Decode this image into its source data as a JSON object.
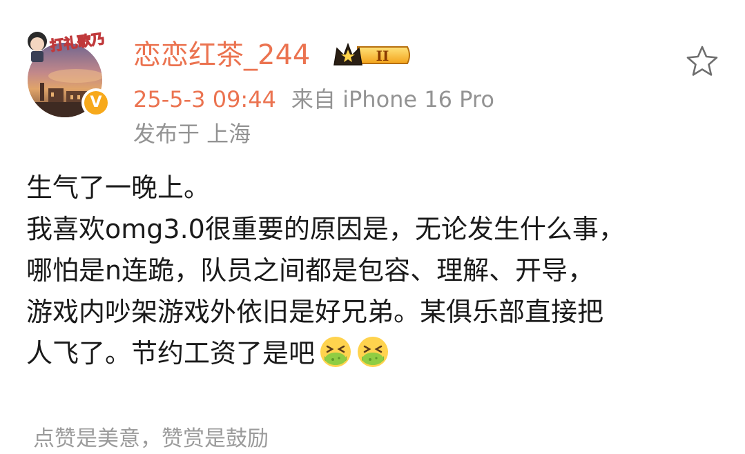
{
  "post": {
    "author": {
      "username": "恋恋红茶_244",
      "avatar_decoration_text": "打礼歌乃",
      "verified_icon": "verified-v-icon",
      "verified_glyph": "V",
      "crown_badge_icon": "crown-badge-icon",
      "crown_badge_level": "II"
    },
    "meta": {
      "time": "25-5-3 09:44",
      "source": "来自 iPhone 16 Pro",
      "location": "发布于 上海"
    },
    "favorite_icon": "star-outline-icon",
    "content_lines": [
      "生气了一晚上。",
      "我喜欢omg3.0很重要的原因是，无论发生什么事，",
      "哪怕是n连跪，队员之间都是包容、理解、开导，",
      "游戏内吵架游戏外依旧是好兄弟。某俱乐部直接把",
      "人飞了。节约工资了是吧"
    ],
    "content_emojis": [
      "nauseated-face-emoji",
      "nauseated-face-emoji"
    ],
    "footer_hint": "点赞是美意，赞赏是鼓励"
  },
  "colors": {
    "username": "#eb7350",
    "time": "#eb7350",
    "meta_gray": "#939393",
    "body_text": "#1a1a1a",
    "verified_badge": "#f7a91b",
    "footer_gray": "#9b9b9b"
  }
}
